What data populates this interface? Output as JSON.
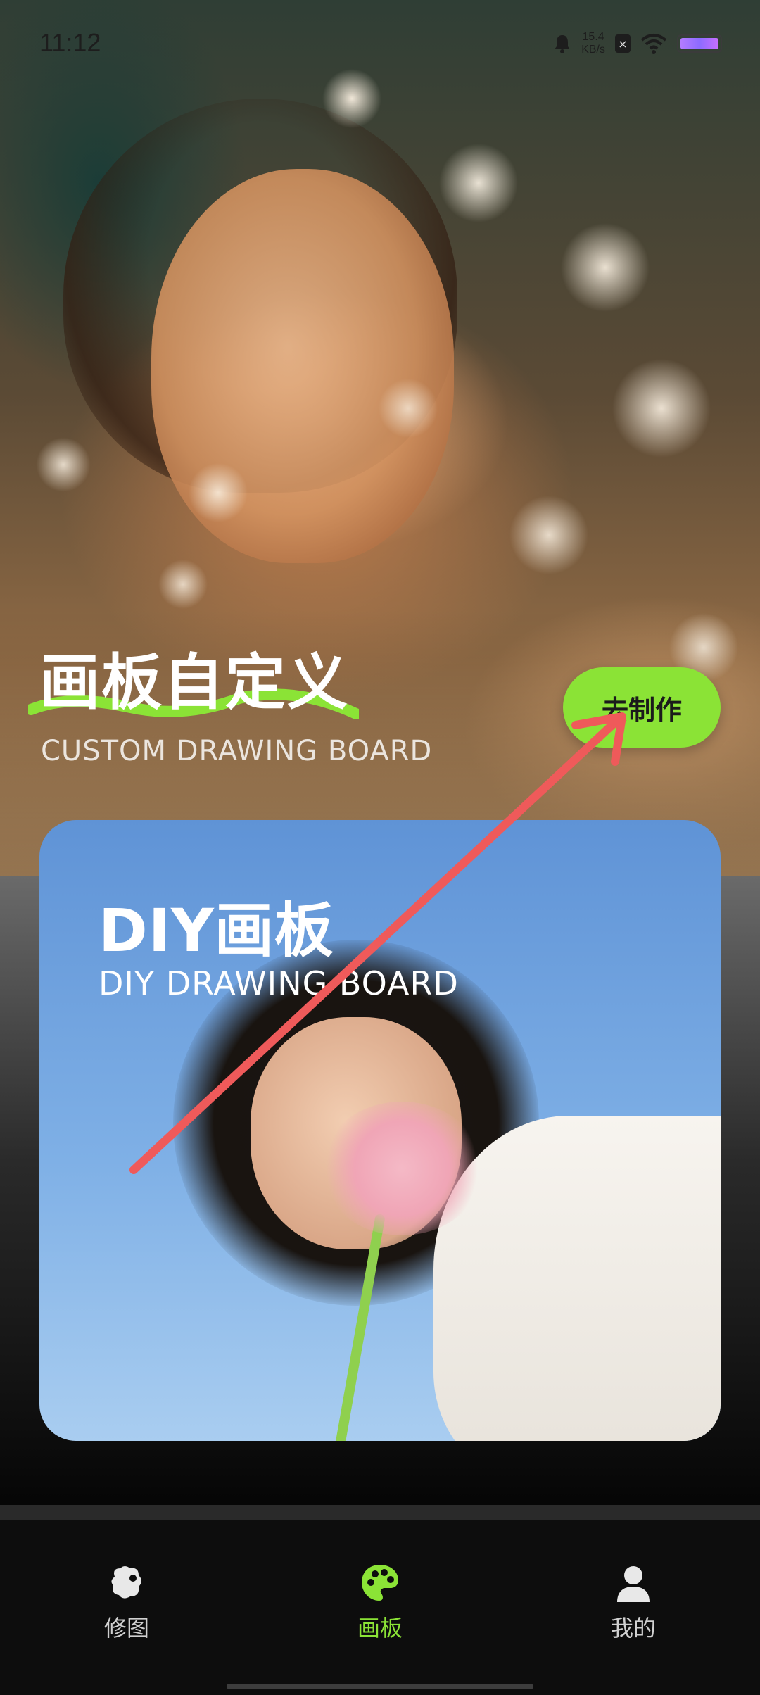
{
  "status_bar": {
    "time": "11:12",
    "net_speed_value": "15.4",
    "net_speed_unit": "KB/s",
    "icons": [
      "alarm-icon",
      "sim-x-icon",
      "wifi-icon",
      "battery-icon"
    ]
  },
  "hero": {
    "title": "画板自定义",
    "subtitle": "CUSTOM DRAWING BOARD",
    "cta_label": "去制作"
  },
  "diy_card": {
    "title": "DIY画板",
    "subtitle": "DIY DRAWING BOARD"
  },
  "bottom_nav": {
    "items": [
      {
        "label": "修图",
        "icon": "edit-photo-icon",
        "active": false
      },
      {
        "label": "画板",
        "icon": "palette-icon",
        "active": true
      },
      {
        "label": "我的",
        "icon": "profile-icon",
        "active": false
      }
    ]
  },
  "colors": {
    "accent": "#8be336",
    "arrow": "#ef5a5a"
  }
}
